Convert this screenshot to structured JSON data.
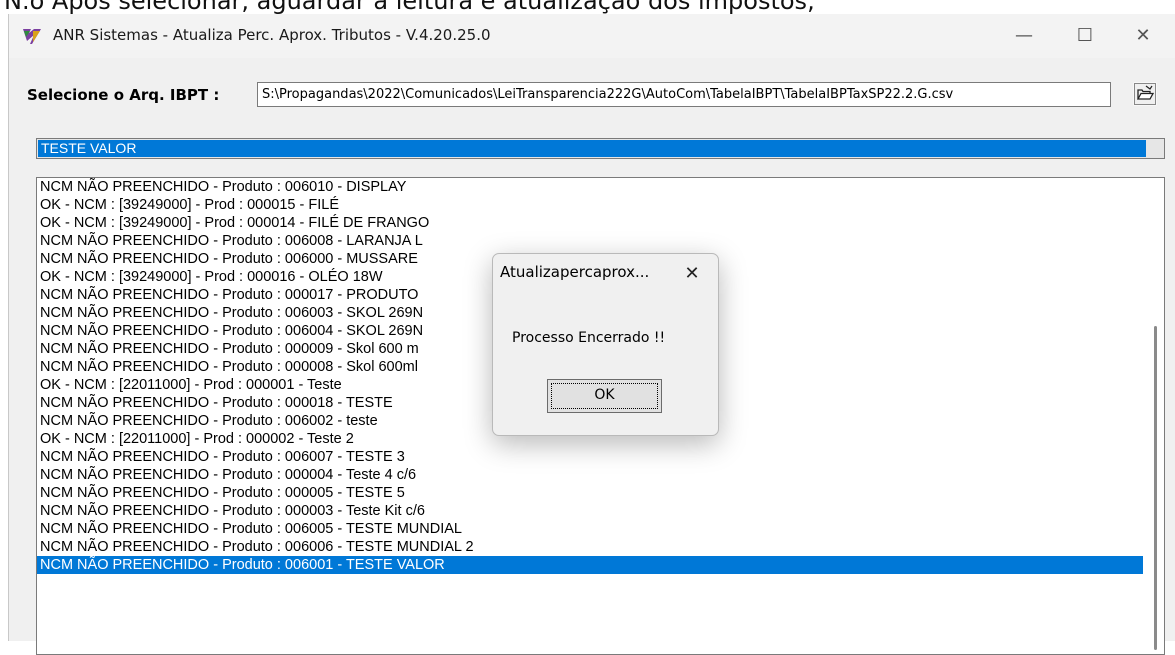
{
  "caption_top": "N.o Apos selecionar, aguardar a leitura e atualização dos impostos;",
  "window": {
    "title": "ANR Sistemas - Atualiza Perc. Aprox. Tributos - V.4.20.25.0",
    "minimize_glyph": "—",
    "maximize_glyph": "☐",
    "close_glyph": "✕"
  },
  "ibpt": {
    "label": "Selecione o Arq. IBPT :",
    "path": "S:\\Propagandas\\2022\\Comunicados\\LeiTransparencia222G\\AutoCom\\TabelaIBPT\\TabelaIBPTaxSP22.2.G.csv",
    "browse_icon": "folder-open-icon"
  },
  "progress": {
    "text": "TESTE VALOR",
    "fraction": 0.985
  },
  "log": [
    "NCM NÃO PREENCHIDO - Produto : 006010 - DISPLAY",
    "OK - NCM : [39249000] - Prod : 000015 - FILÉ",
    "OK - NCM : [39249000] - Prod : 000014 - FILÉ DE FRANGO",
    "NCM NÃO PREENCHIDO - Produto : 006008 - LARANJA L",
    "NCM NÃO PREENCHIDO - Produto : 006000 - MUSSARE",
    "OK - NCM : [39249000] - Prod : 000016 - OLÉO 18W",
    "NCM NÃO PREENCHIDO - Produto : 000017 - PRODUTO",
    "NCM NÃO PREENCHIDO - Produto : 006003 - SKOL 269N",
    "NCM NÃO PREENCHIDO - Produto : 006004 - SKOL 269N",
    "NCM NÃO PREENCHIDO - Produto : 000009 - Skol 600 m",
    "NCM NÃO PREENCHIDO - Produto : 000008 - Skol 600ml",
    "OK - NCM : [22011000] - Prod : 000001 - Teste",
    "NCM NÃO PREENCHIDO - Produto : 000018 - TESTE",
    "NCM NÃO PREENCHIDO - Produto : 006002 - teste",
    "OK - NCM : [22011000] - Prod : 000002 - Teste 2",
    "NCM NÃO PREENCHIDO - Produto : 006007 - TESTE 3",
    "NCM NÃO PREENCHIDO - Produto : 000004 - Teste 4 c/6",
    "NCM NÃO PREENCHIDO - Produto : 000005 - TESTE 5",
    "NCM NÃO PREENCHIDO - Produto : 000003 - Teste Kit c/6",
    "NCM NÃO PREENCHIDO - Produto : 006005 - TESTE MUNDIAL",
    "NCM NÃO PREENCHIDO - Produto : 006006 - TESTE MUNDIAL 2",
    "NCM NÃO PREENCHIDO - Produto : 006001 - TESTE VALOR"
  ],
  "selected_index": 21,
  "dialog": {
    "title": "Atualizapercaprox...",
    "close_glyph": "✕",
    "message": "Processo Encerrado !!",
    "ok_label": "OK"
  },
  "colors": {
    "accent": "#0078d7"
  }
}
